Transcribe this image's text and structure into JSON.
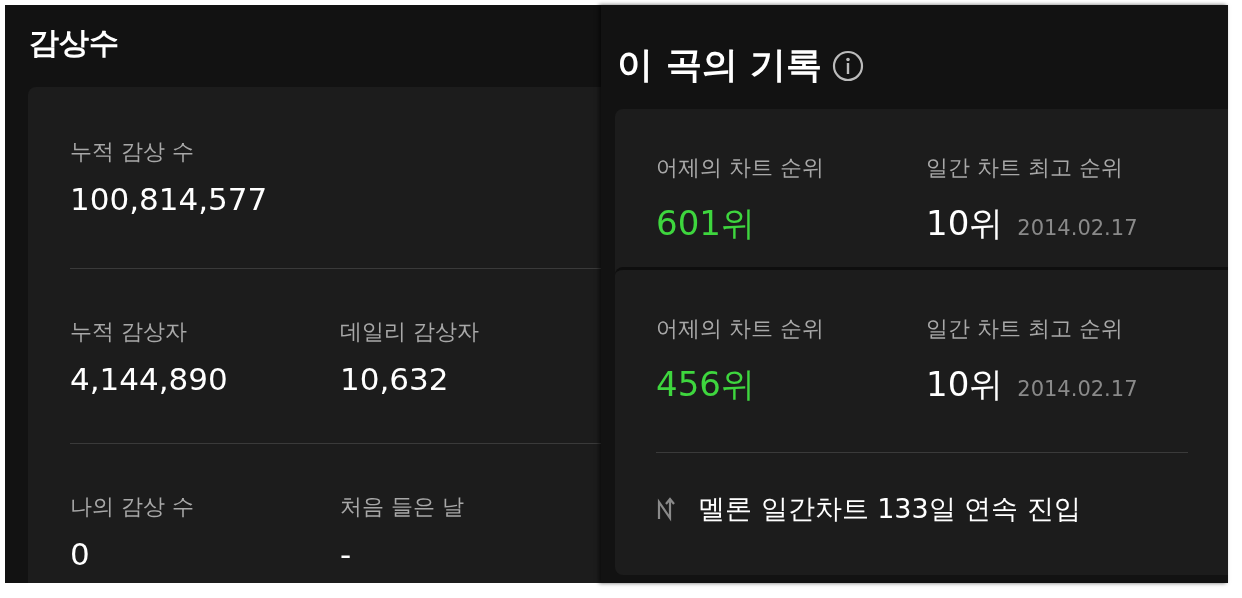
{
  "stream_panel": {
    "title": "감상수",
    "rows": [
      [
        {
          "label": "누적 감상 수",
          "value": "100,814,577"
        }
      ],
      [
        {
          "label": "누적 감상자",
          "value": "4,144,890"
        },
        {
          "label": "데일리 감상자",
          "value": "10,632"
        }
      ],
      [
        {
          "label": "나의 감상 수",
          "value": "0"
        },
        {
          "label": "처음 들은 날",
          "value": "-"
        }
      ]
    ]
  },
  "record_panel": {
    "title": "이 곡의 기록",
    "cards": [
      {
        "stats": [
          {
            "kind": "current",
            "label": "어제의 차트 순위",
            "value": "601위"
          },
          {
            "kind": "best",
            "label": "일간 차트 최고 순위",
            "value": "10위",
            "date": "2014.02.17"
          }
        ]
      },
      {
        "stats": [
          {
            "kind": "current",
            "label": "어제의 차트 순위",
            "value": "456위"
          },
          {
            "kind": "best",
            "label": "일간 차트 최고 순위",
            "value": "10위",
            "date": "2014.02.17"
          }
        ],
        "note": "멜론 일간차트 133일 연속 진입"
      }
    ]
  }
}
